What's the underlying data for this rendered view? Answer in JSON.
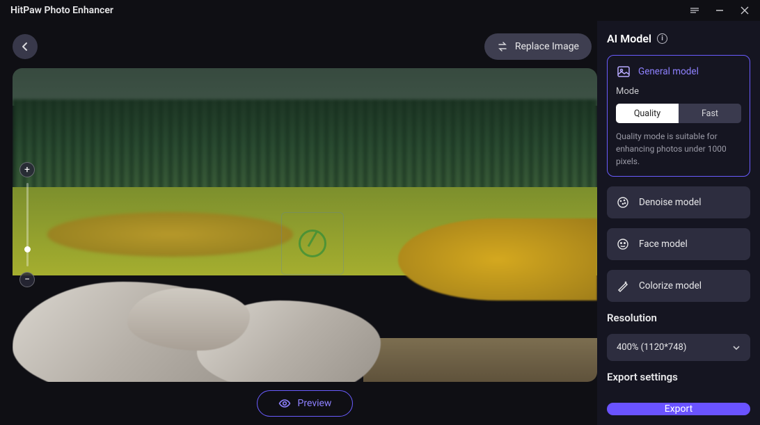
{
  "app_title": "HitPaw Photo Enhancer",
  "topbar": {
    "replace_label": "Replace Image"
  },
  "preview": {
    "label": "Preview"
  },
  "ai_model": {
    "title": "AI Model",
    "general": {
      "label": "General model",
      "mode_label": "Mode",
      "options": {
        "quality": "Quality",
        "fast": "Fast"
      },
      "selected": "quality",
      "description": "Quality mode is suitable for enhancing photos under 1000 pixels."
    },
    "denoise": {
      "label": "Denoise model"
    },
    "face": {
      "label": "Face model"
    },
    "colorize": {
      "label": "Colorize model"
    }
  },
  "resolution": {
    "title": "Resolution",
    "value": "400% (1120*748)"
  },
  "export": {
    "section_title": "Export settings",
    "button": "Export"
  }
}
